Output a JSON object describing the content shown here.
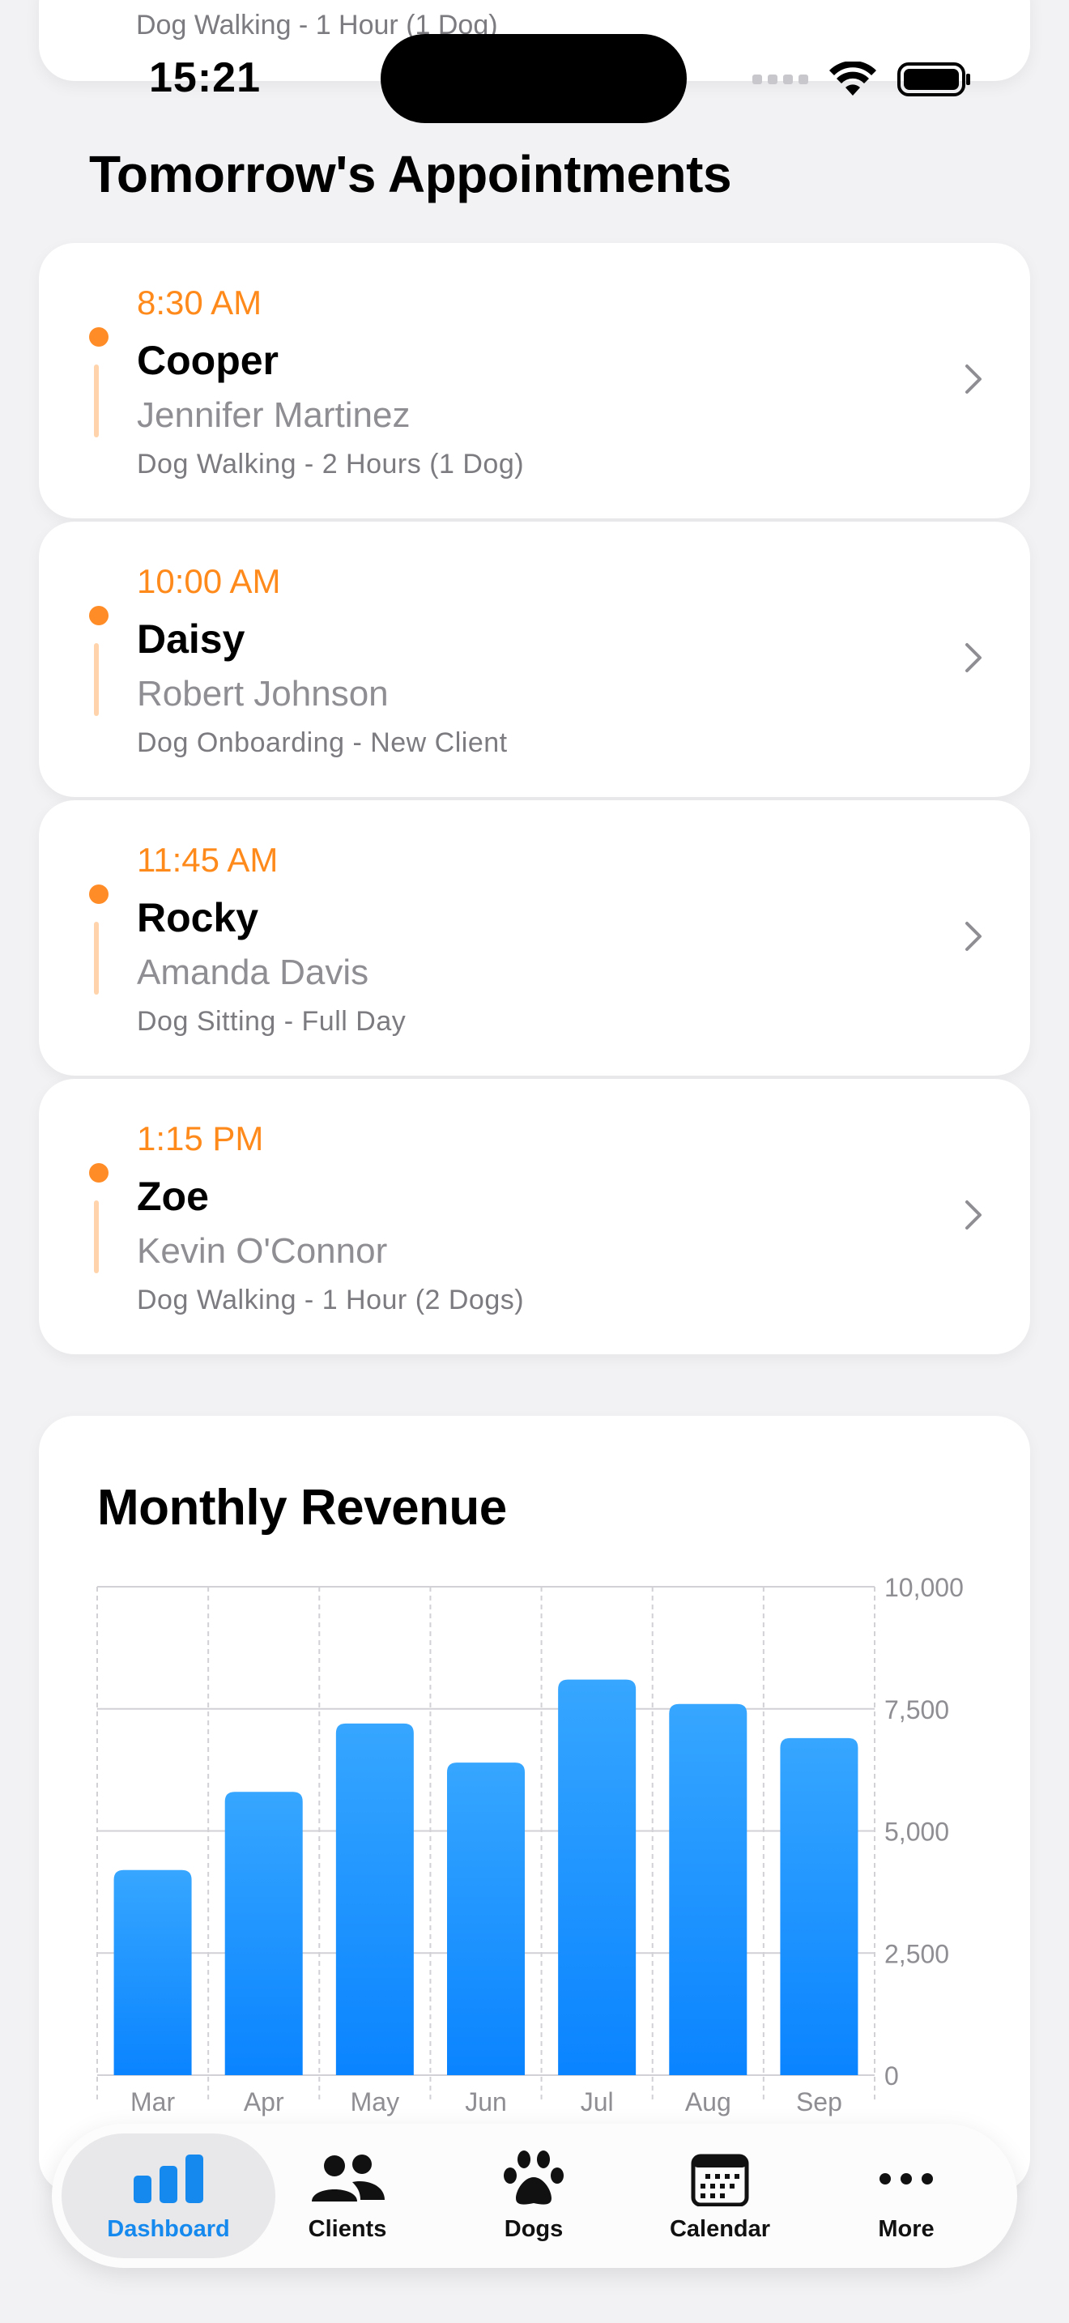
{
  "status_bar": {
    "time": "15:21"
  },
  "previous_card": {
    "service": "Dog Walking - 1 Hour (1 Dog)"
  },
  "section": {
    "title": "Tomorrow's Appointments"
  },
  "appointments": [
    {
      "time": "8:30 AM",
      "dog": "Cooper",
      "owner": "Jennifer Martinez",
      "service": "Dog Walking - 2 Hours (1 Dog)"
    },
    {
      "time": "10:00 AM",
      "dog": "Daisy",
      "owner": "Robert Johnson",
      "service": "Dog Onboarding - New Client"
    },
    {
      "time": "11:45 AM",
      "dog": "Rocky",
      "owner": "Amanda Davis",
      "service": "Dog Sitting - Full Day"
    },
    {
      "time": "1:15 PM",
      "dog": "Zoe",
      "owner": "Kevin O'Connor",
      "service": "Dog Walking - 1 Hour (2 Dogs)"
    }
  ],
  "revenue": {
    "title": "Monthly Revenue"
  },
  "chart_data": {
    "type": "bar",
    "title": "Monthly Revenue",
    "categories": [
      "Mar",
      "Apr",
      "May",
      "Jun",
      "Jul",
      "Aug",
      "Sep"
    ],
    "values": [
      4200,
      5800,
      7200,
      6400,
      8100,
      7600,
      6900
    ],
    "ylim": [
      0,
      10000
    ],
    "yticks": [
      "0",
      "2,500",
      "5,000",
      "7,500",
      "10,000"
    ],
    "ytick_values": [
      0,
      2500,
      5000,
      7500,
      10000
    ],
    "grid": true,
    "bar_color": "#1a8fff"
  },
  "tabs": [
    {
      "label": "Dashboard",
      "icon": "chart-bar-icon",
      "active": true
    },
    {
      "label": "Clients",
      "icon": "people-icon",
      "active": false
    },
    {
      "label": "Dogs",
      "icon": "paw-icon",
      "active": false
    },
    {
      "label": "Calendar",
      "icon": "calendar-icon",
      "active": false
    },
    {
      "label": "More",
      "icon": "ellipsis-icon",
      "active": false
    }
  ],
  "colors": {
    "accent": "#ff8a1c",
    "tab_active": "#1589ee",
    "bar": "#1a8fff"
  }
}
